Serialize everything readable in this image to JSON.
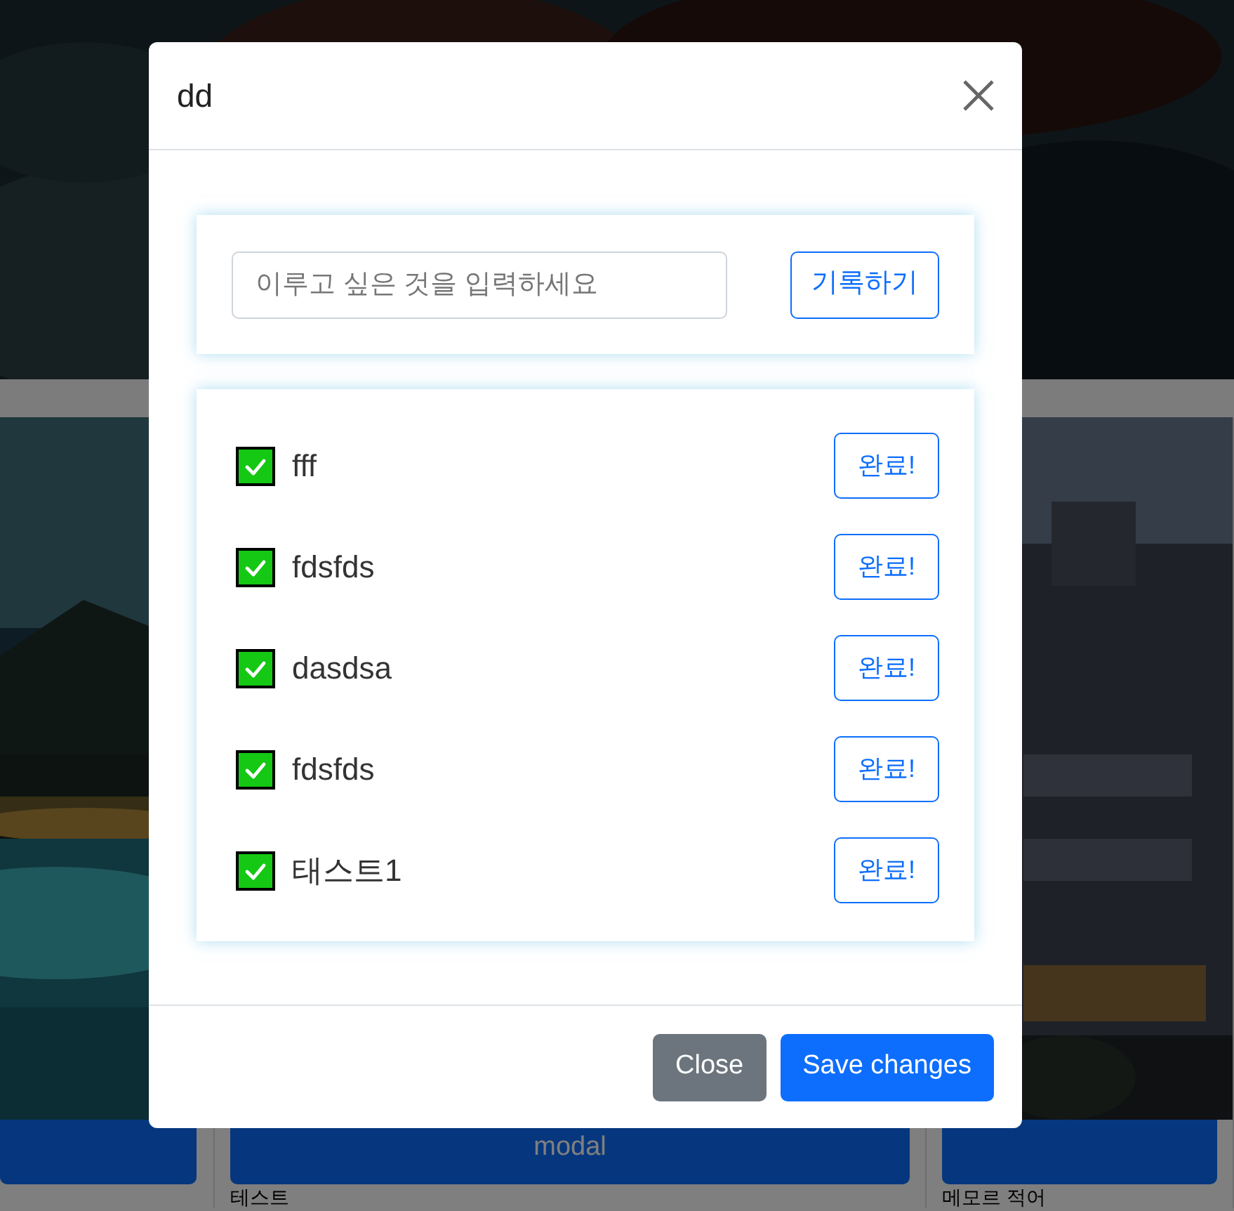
{
  "background": {
    "cards": [
      {
        "kind": "resort"
      },
      {
        "kind": "hidden",
        "button": "modal",
        "caption": "테스트"
      },
      {
        "kind": "building",
        "caption": "메모르 적어"
      }
    ]
  },
  "modal": {
    "title": "dd",
    "form": {
      "placeholder": "이루고 싶은 것을 입력하세요",
      "button": "기록하기"
    },
    "todos": [
      {
        "text": "fff",
        "checked": true,
        "button": "완료!"
      },
      {
        "text": "fdsfds",
        "checked": true,
        "button": "완료!"
      },
      {
        "text": "dasdsa",
        "checked": true,
        "button": "완료!"
      },
      {
        "text": "fdsfds",
        "checked": true,
        "button": "완료!"
      },
      {
        "text": "태스트1",
        "checked": true,
        "button": "완료!"
      }
    ],
    "footer": [
      {
        "label": "Close",
        "kind": "secondary"
      },
      {
        "label": "Save changes",
        "kind": "primary"
      }
    ]
  }
}
